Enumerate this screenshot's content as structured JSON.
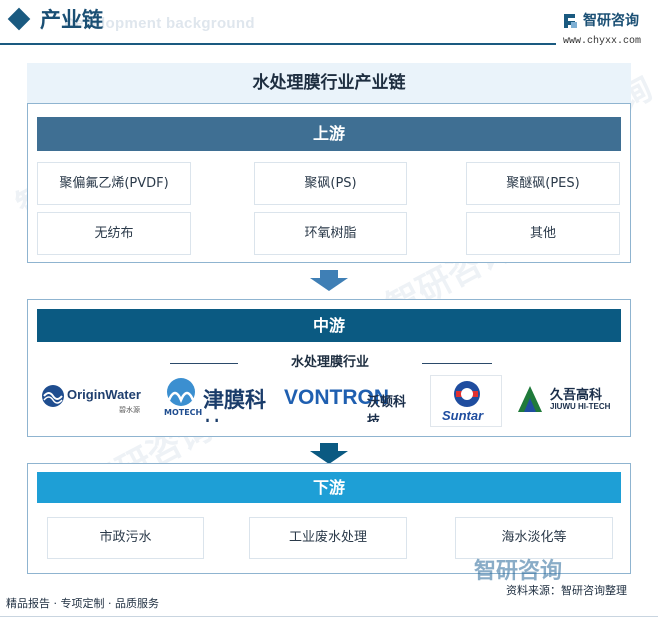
{
  "header": {
    "title": "产业链",
    "bg_text": "Development background",
    "logo_name": "智研咨询",
    "logo_url": "www.chyxx.com"
  },
  "watermark": "智研咨询",
  "main_title": "水处理膜行业产业链",
  "upstream": {
    "title": "上游",
    "items": [
      "聚偏氟乙烯(PVDF)",
      "聚砜(PS)",
      "聚醚砜(PES)",
      "无纺布",
      "环氧树脂",
      "其他"
    ]
  },
  "midstream": {
    "title": "中游",
    "label": "水处理膜行业",
    "logos": [
      {
        "name": "OriginWater",
        "sub": "碧水源"
      },
      {
        "name": "津膜科技",
        "sub": "MOTECH"
      },
      {
        "name": "VONTRON",
        "sub": "沃顿科技"
      },
      {
        "name": "Suntar",
        "sub": ""
      },
      {
        "name": "久吾高科",
        "sub": "JIUWU HI-TECH"
      }
    ]
  },
  "downstream": {
    "title": "下游",
    "items": [
      "市政污水",
      "工业废水处理",
      "海水淡化等"
    ]
  },
  "footer": {
    "left": "精品报告 · 专项定制 · 品质服务",
    "source": "资料来源：智研咨询整理",
    "logo_text": "智研咨询"
  },
  "colors": {
    "upstream_head": "#3f6f93",
    "midstream_head": "#0b5a82",
    "downstream_head": "#1e9fd6",
    "arrow": "#3f7fb5"
  }
}
